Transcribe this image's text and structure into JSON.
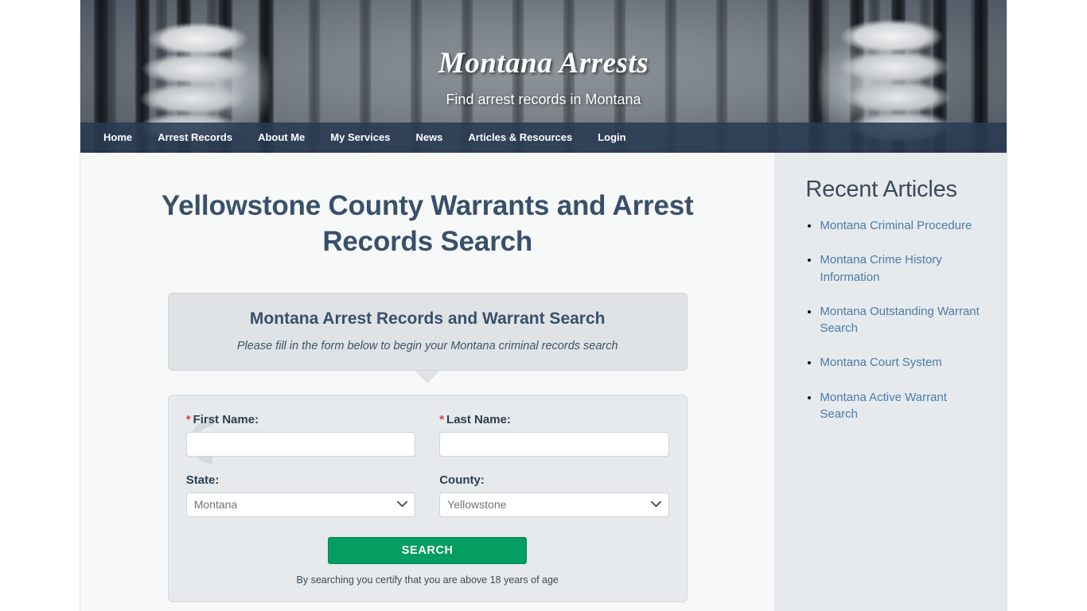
{
  "site": {
    "title": "Montana Arrests",
    "tagline": "Find arrest records in Montana"
  },
  "nav": {
    "items": [
      {
        "label": "Home"
      },
      {
        "label": "Arrest Records"
      },
      {
        "label": "About Me"
      },
      {
        "label": "My Services"
      },
      {
        "label": "News"
      },
      {
        "label": "Articles & Resources"
      },
      {
        "label": "Login"
      }
    ]
  },
  "main": {
    "page_title": "Yellowstone County Warrants and Arrest Records Search",
    "callout": {
      "heading": "Montana Arrest Records and Warrant Search",
      "subtext": "Please fill in the form below to begin your Montana criminal records search"
    },
    "form": {
      "first_name": {
        "label": "First Name:",
        "required_marker": "*",
        "value": "",
        "placeholder": ""
      },
      "last_name": {
        "label": "Last Name:",
        "required_marker": "*",
        "value": "",
        "placeholder": ""
      },
      "state": {
        "label": "State:",
        "selected": "Montana",
        "options": [
          "Montana"
        ]
      },
      "county": {
        "label": "County:",
        "selected": "Yellowstone",
        "options": [
          "Yellowstone"
        ]
      },
      "submit_label": "SEARCH",
      "certify_note": "By searching you certify that you are above 18 years of age"
    }
  },
  "sidebar": {
    "heading": "Recent Articles",
    "articles": [
      {
        "label": "Montana Criminal Procedure"
      },
      {
        "label": "Montana Crime History Information"
      },
      {
        "label": "Montana Outstanding Warrant Search"
      },
      {
        "label": "Montana Court System"
      },
      {
        "label": "Montana Active Warrant Search"
      }
    ]
  },
  "colors": {
    "heading": "#39506b",
    "nav_bg": "#293a52",
    "link": "#4a7aab",
    "button": "#059e62",
    "required": "#e03a3a",
    "sidebar_bg": "#e6eaec"
  },
  "icons": {
    "chevron_down": "ˇ"
  }
}
